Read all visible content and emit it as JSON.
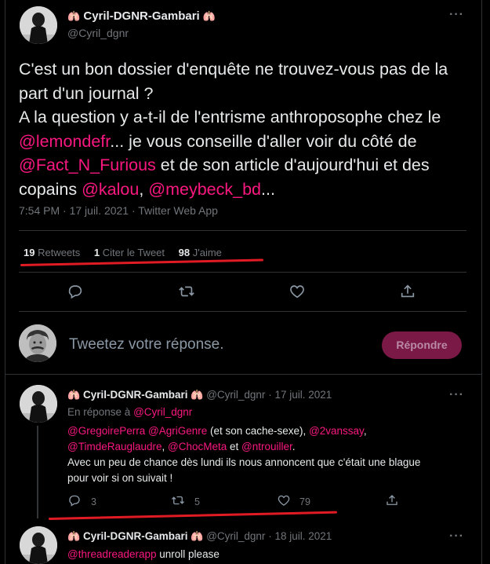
{
  "main_tweet": {
    "author_name": "Cyril-DGNR-Gambari",
    "name_emoji": "🫁",
    "handle": "@Cyril_dgnr",
    "more": "···",
    "line1_text": "C'est un bon dossier d'enquête ne trouvez-vous pas de la part d'un journal ?",
    "line2_a": "A la question y a-t-il de l'entrisme anthroposophe chez le ",
    "mention_lemonde": "@lemondefr",
    "line2_b": "... je vous conseille d'aller voir du côté de ",
    "mention_fact": "@Fact_N_Furious",
    "line2_c": " et de son article d'aujourd'hui et des copains ",
    "mention_kalou": "@kalou",
    "comma": ", ",
    "mention_meybeck": "@meybeck_bd",
    "ellipsis": "...",
    "meta": "7:54 PM · 17 juil. 2021 · Twitter Web App",
    "retweets_count": "19",
    "retweets_label": "Retweets",
    "quotes_count": "1",
    "quotes_label": "Citer le Tweet",
    "likes_count": "98",
    "likes_label": "J'aime"
  },
  "icons": {
    "reply": "reply-icon",
    "retweet": "retweet-icon",
    "like": "heart-icon",
    "share": "share-icon"
  },
  "reply_box": {
    "placeholder": "Tweetez votre réponse.",
    "button": "Répondre"
  },
  "reply1": {
    "author_name": "Cyril-DGNR-Gambari",
    "handle": "@Cyril_dgnr",
    "dot": "·",
    "date": "17 juil. 2021",
    "in_reply_prefix": "En réponse à ",
    "in_reply_handle": "@Cyril_dgnr",
    "m1": "@GregoirePerra",
    "m2": "@AgriGenre",
    "t1": " (et son cache-sexe), ",
    "m3": "@2vanssay",
    "t2": ",",
    "m4": "@TimdeRauglaudre",
    "t3": ", ",
    "m5": "@ChocMeta",
    "t4": " et ",
    "m6": "@ntrouiller",
    "t5": ".",
    "body_line": "Avec un peu de chance dès lundi ils nous annoncent que c'était une blague pour voir si on suivait !",
    "replies": "3",
    "retweets": "5",
    "likes": "79"
  },
  "reply2": {
    "author_name": "Cyril-DGNR-Gambari",
    "handle": "@Cyril_dgnr",
    "dot": "·",
    "date": "18 juil. 2021",
    "mention": "@threadreaderapp",
    "text": " unroll please"
  }
}
